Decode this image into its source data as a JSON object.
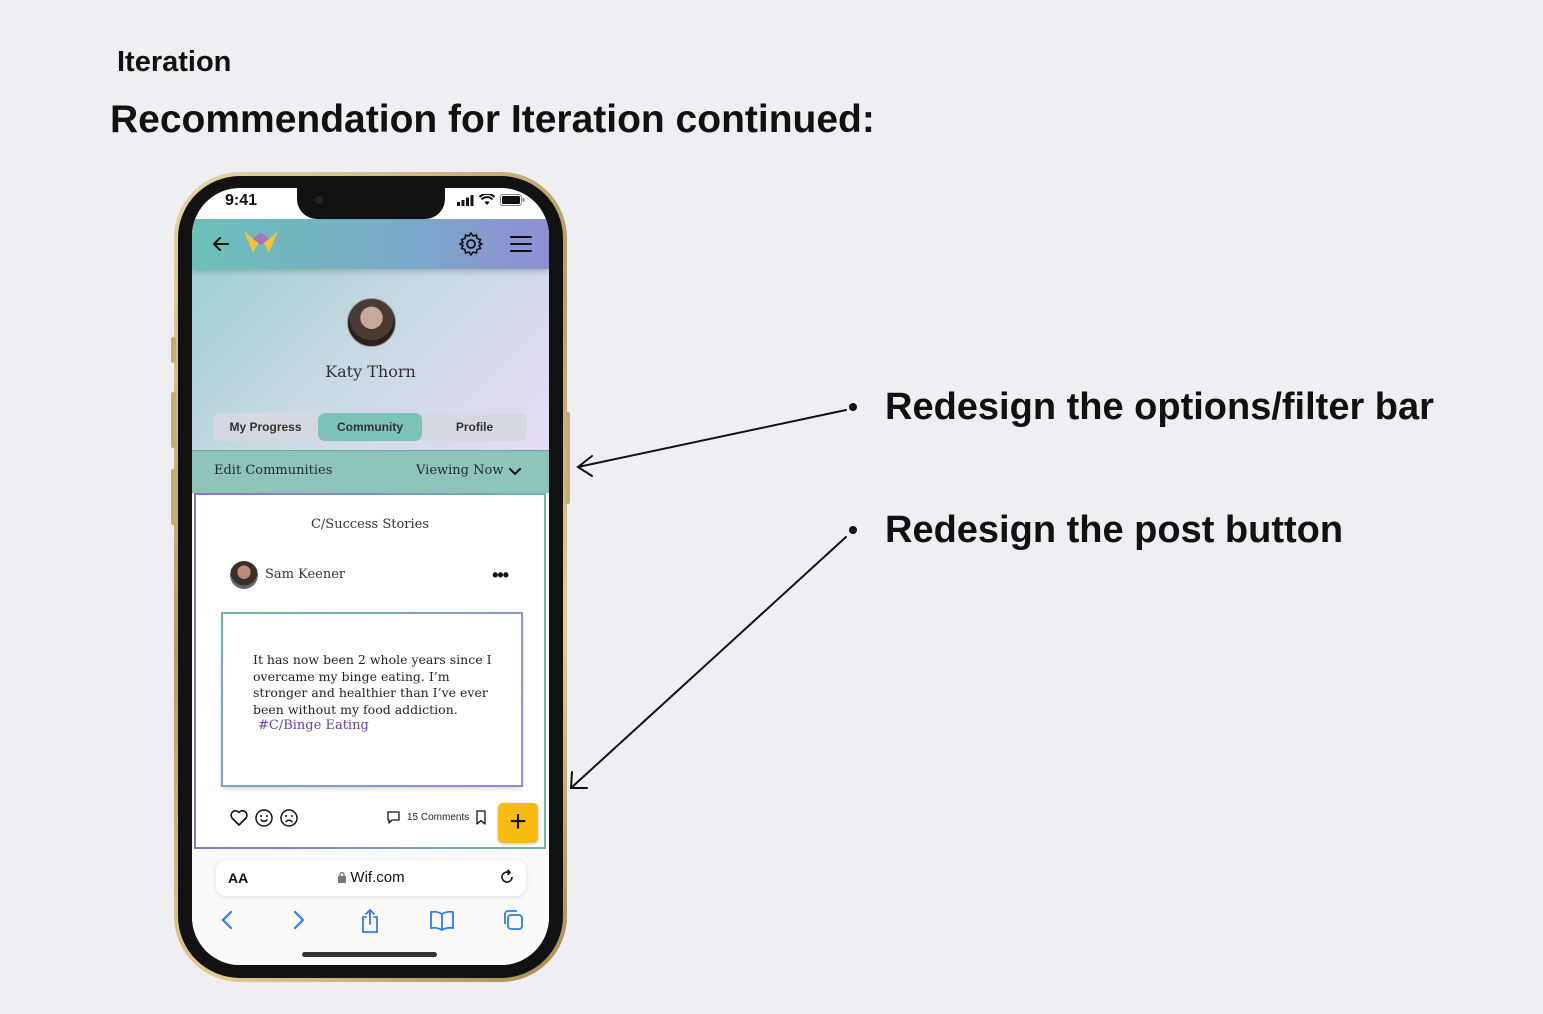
{
  "slide": {
    "kicker": "Iteration",
    "title": "Recommendation for Iteration continued:"
  },
  "status_bar": {
    "time": "9:41"
  },
  "profile": {
    "name": "Katy Thorn"
  },
  "tabs": [
    {
      "label": "My Progress",
      "active": false
    },
    {
      "label": "Community",
      "active": true
    },
    {
      "label": "Profile",
      "active": false
    }
  ],
  "filter_bar": {
    "edit_label": "Edit Communities",
    "viewing_label": "Viewing Now"
  },
  "feed": {
    "community": "C/Success Stories",
    "post": {
      "author": "Sam Keener",
      "text": "It has now been 2 whole years since I overcame my binge eating. I’m stronger and healthier than I’ve ever been without my food addiction.",
      "tag": "#C/Binge Eating",
      "comments_label": "15 Comments"
    },
    "post_button_label": "+"
  },
  "browser": {
    "aa_label": "AA",
    "url": "Wif.com"
  },
  "annotations": [
    {
      "text": "Redesign the options/filter bar"
    },
    {
      "text": "Redesign the post button"
    }
  ],
  "colors": {
    "accent_teal": "#7cc2b7",
    "post_button": "#f6bb0f",
    "tag_purple": "#6a3fa4"
  }
}
